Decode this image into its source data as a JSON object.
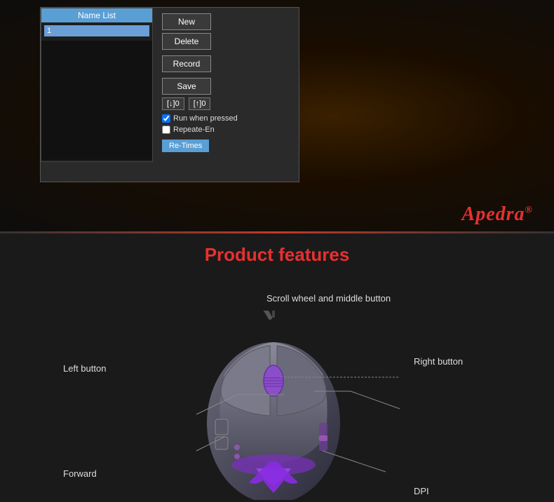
{
  "top": {
    "dialog": {
      "name_list_header": "Name List",
      "name_list_value": "1",
      "btn_new": "New",
      "btn_delete": "Delete",
      "btn_record": "Record",
      "btn_save": "Save",
      "counter_down": "[↓]0",
      "counter_up": "[↑]0",
      "run_when_pressed_label": "Run when pressed",
      "run_when_pressed_checked": true,
      "repeat_en_label": "Repeate-En",
      "repeat_en_checked": false,
      "retimes_label": "Re-Times"
    }
  },
  "brand": {
    "name": "Apedra",
    "reg": "®"
  },
  "features": {
    "title": "Product features",
    "labels": {
      "scroll_wheel": "Scroll wheel and middle button",
      "left_button": "Left button",
      "right_button": "Right button",
      "forward": "Forward",
      "dpi": "DPI"
    }
  }
}
